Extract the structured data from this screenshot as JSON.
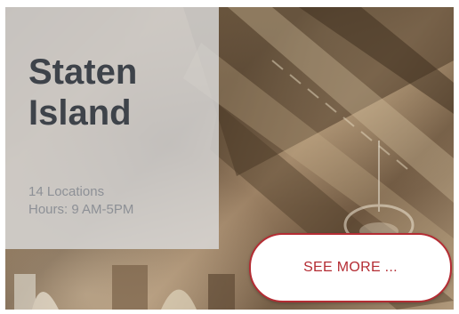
{
  "location": {
    "title_line1": "Staten",
    "title_line2": "Island",
    "locations_count": "14 Locations",
    "hours": "Hours: 9 AM-5PM"
  },
  "cta": {
    "label": "SEE MORE ..."
  },
  "colors": {
    "accent": "#b42c33",
    "title_text": "#3e434a",
    "meta_text": "#8d9096",
    "panel_bg": "#dadada"
  },
  "image": {
    "subject": "ornate library ceiling"
  }
}
